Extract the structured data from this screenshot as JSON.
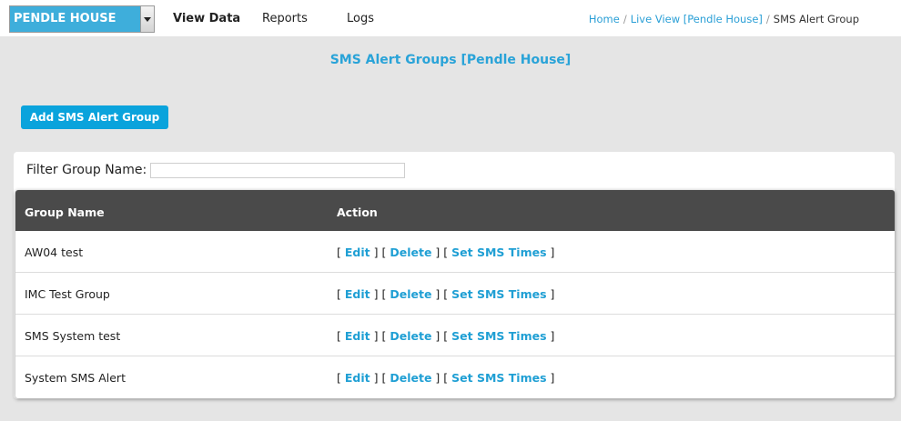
{
  "site_selector": {
    "value": "PENDLE HOUSE"
  },
  "nav": {
    "items": [
      {
        "label": "View Data",
        "active": true
      },
      {
        "label": "Reports",
        "active": false
      },
      {
        "label": "Logs",
        "active": false
      }
    ]
  },
  "breadcrumb": {
    "items": [
      {
        "label": "Home",
        "link": true
      },
      {
        "label": "Live View [Pendle House]",
        "link": true
      },
      {
        "label": "SMS Alert Group",
        "link": false
      }
    ],
    "separator": "/"
  },
  "page": {
    "title": "SMS Alert Groups [Pendle House]",
    "add_button_label": "Add SMS Alert Group"
  },
  "filter": {
    "label": "Filter Group Name:",
    "value": ""
  },
  "table": {
    "columns": [
      "Group Name",
      "Action"
    ],
    "action_labels": {
      "open": "[",
      "close": "]",
      "edit": "Edit",
      "delete": "Delete",
      "set_times": "Set SMS Times"
    },
    "rows": [
      {
        "name": "AW04 test"
      },
      {
        "name": "IMC Test Group"
      },
      {
        "name": "SMS System test"
      },
      {
        "name": "System SMS Alert"
      }
    ]
  },
  "colors": {
    "accent": "#29a3d8",
    "button": "#0aa3dc",
    "site_selector": "#3eaedb",
    "table_header": "#4a4a4a",
    "background": "#e5e5e5"
  }
}
